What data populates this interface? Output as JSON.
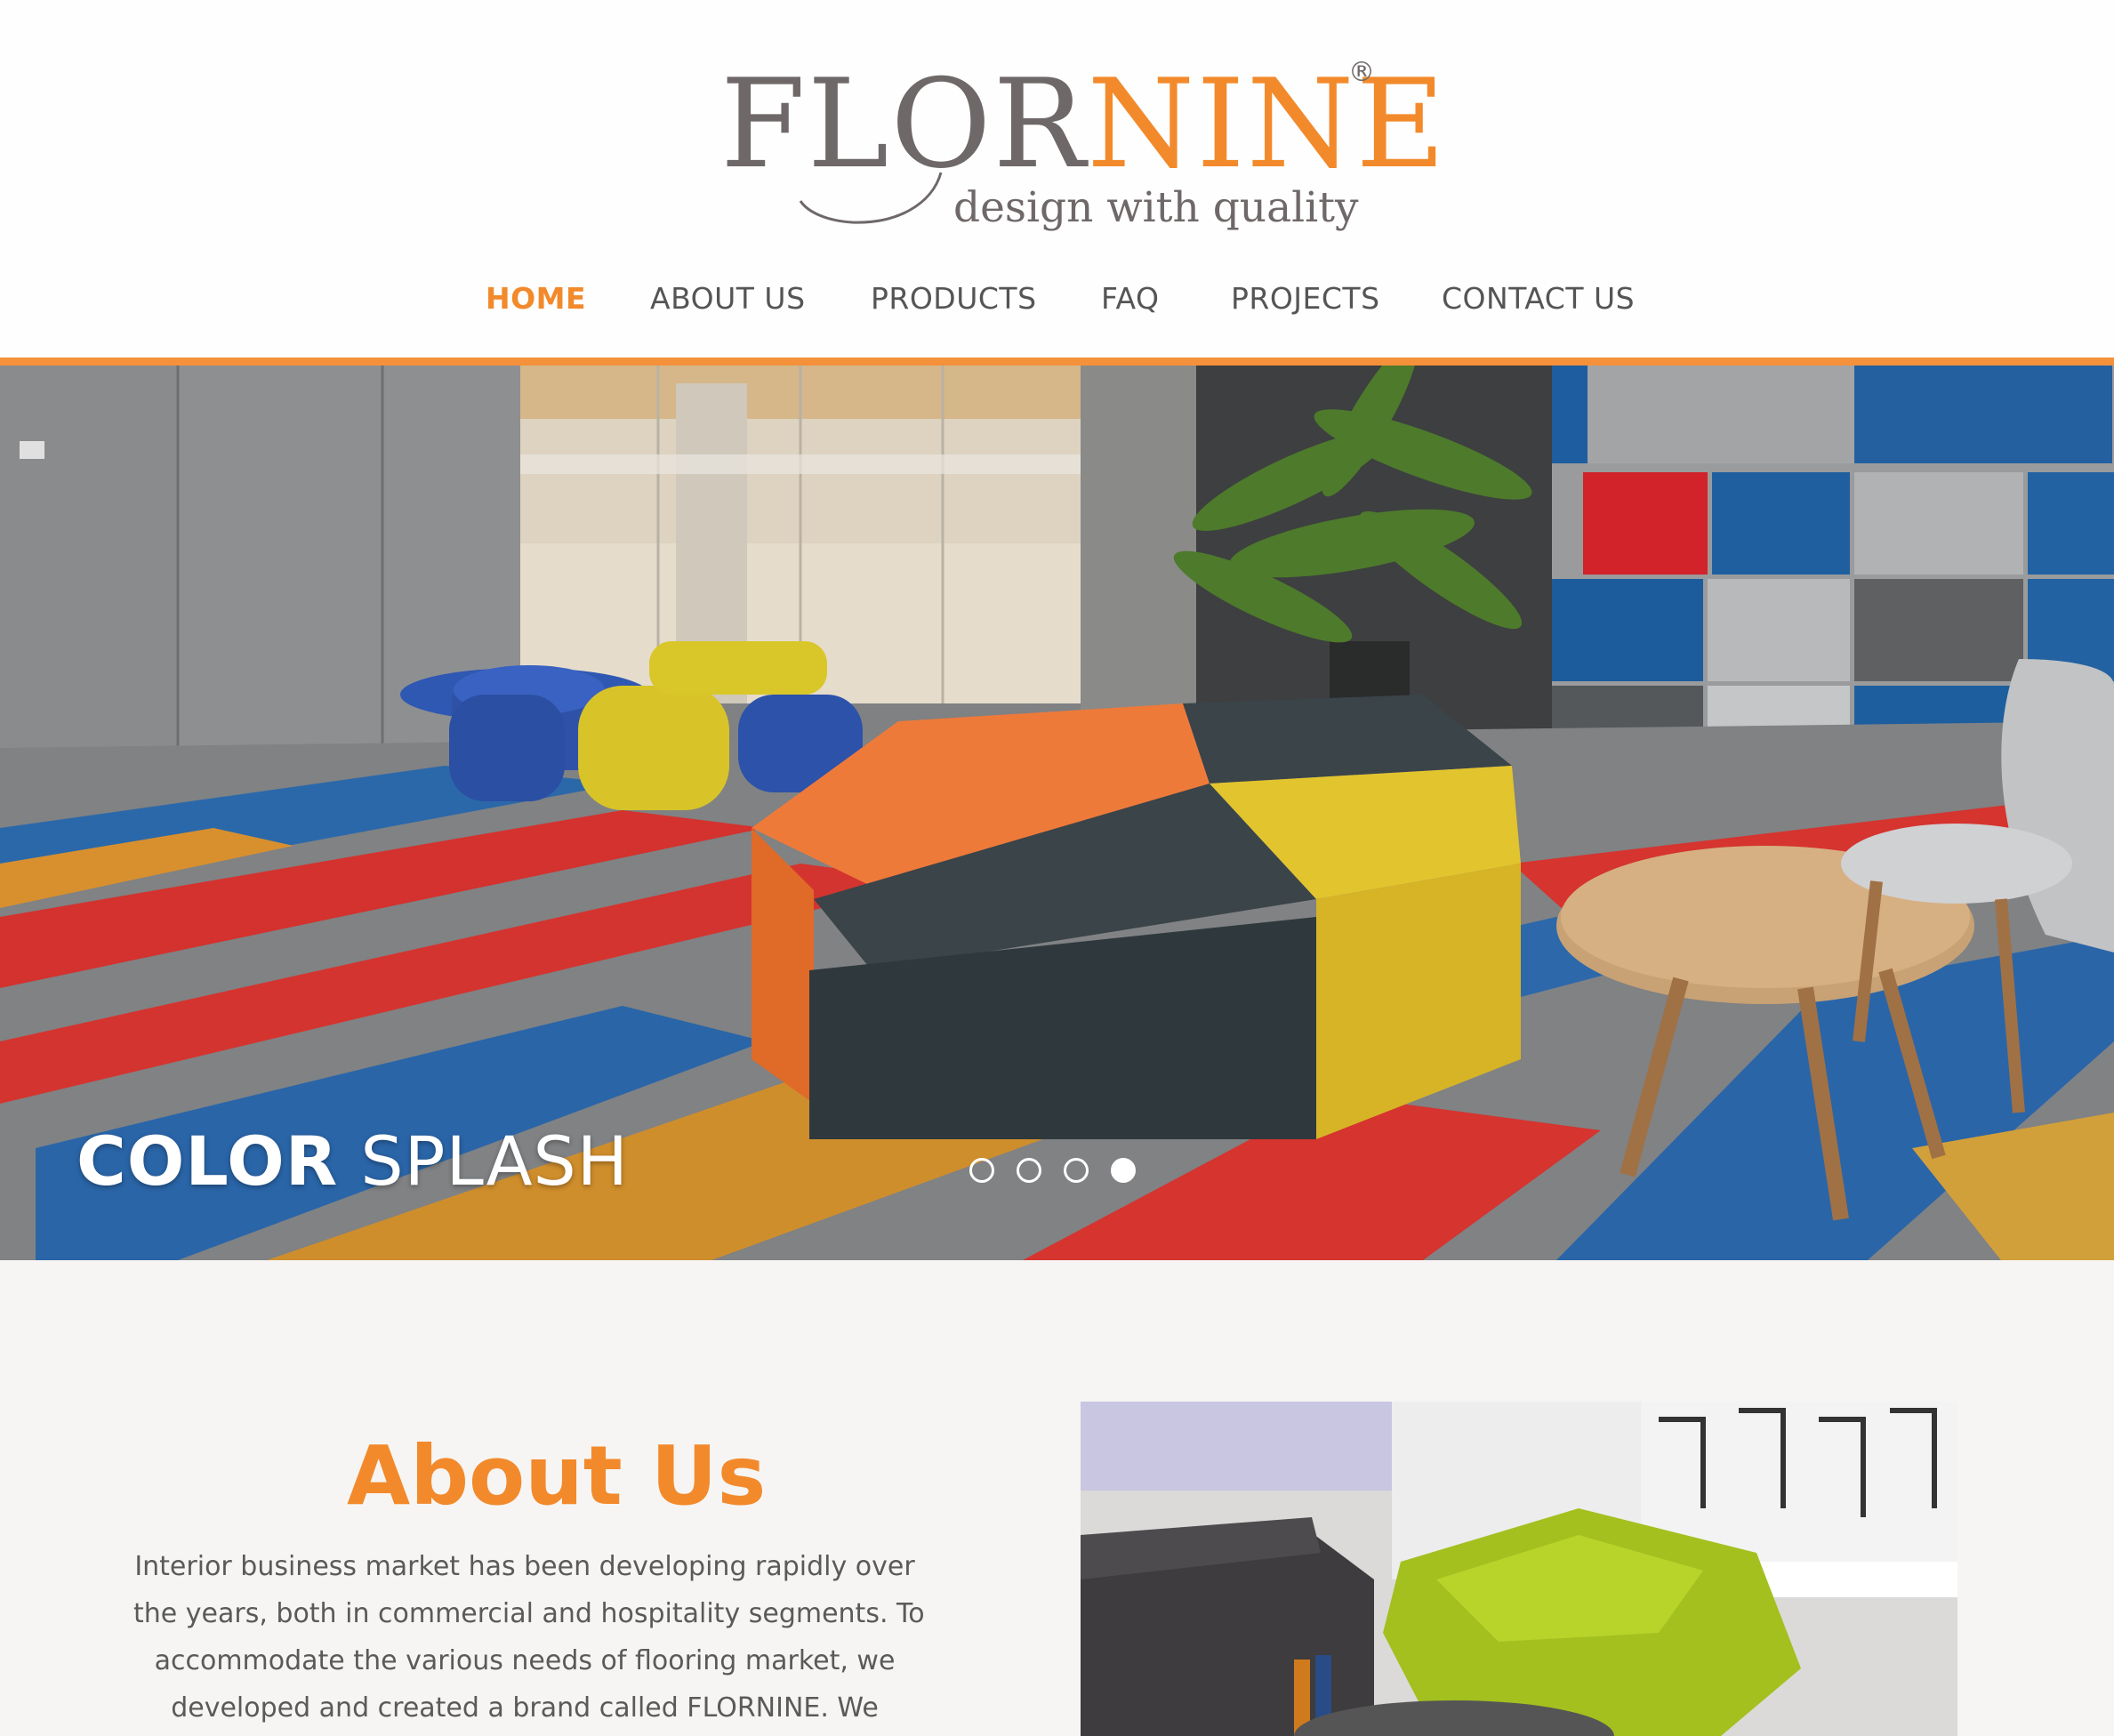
{
  "brand": {
    "name_part1": "FLOR",
    "name_part2": "NINE",
    "registered": "®",
    "tagline": "design with quality"
  },
  "nav": {
    "items": [
      {
        "label": "HOME",
        "active": true
      },
      {
        "label": "ABOUT US",
        "active": false
      },
      {
        "label": "PRODUCTS",
        "active": false
      },
      {
        "label": "FAQ",
        "active": false
      },
      {
        "label": "PROJECTS",
        "active": false
      },
      {
        "label": "CONTACT US",
        "active": false
      }
    ]
  },
  "hero": {
    "caption_bold": "COLOR",
    "caption_light": "SPLASH",
    "slide_count": 4,
    "active_slide": 4
  },
  "about": {
    "title": "About Us",
    "lines": [
      "Interior business market has been developing rapidly over",
      "the years, both in commercial and hospitality segments. To",
      "accommodate the various needs of flooring market, we",
      "developed and created a brand called FLORNINE. We"
    ]
  },
  "colors": {
    "accent": "#f28a2c",
    "rule": "#f4913a",
    "text": "#555555"
  }
}
